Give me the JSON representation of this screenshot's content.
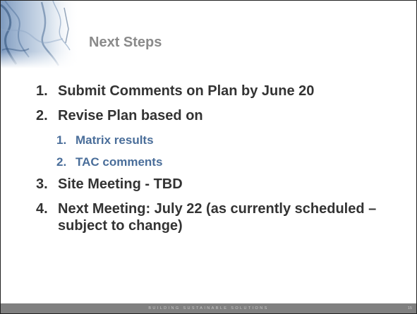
{
  "slide": {
    "title": "Next Steps",
    "items": [
      {
        "num": "1.",
        "text": "Submit Comments on Plan by June 20"
      },
      {
        "num": "2.",
        "text": "Revise Plan based on",
        "subitems": [
          {
            "num": "1.",
            "text": "Matrix results"
          },
          {
            "num": "2.",
            "text": "TAC comments"
          }
        ]
      },
      {
        "num": "3.",
        "text": "Site Meeting - TBD"
      },
      {
        "num": "4.",
        "text": "Next Meeting: July 22 (as currently scheduled – subject to change)"
      }
    ],
    "footer_tagline": "BUILDING SUSTAINABLE SOLUTIONS",
    "page_number": "15"
  },
  "colors": {
    "title": "#8a8a8a",
    "body_text": "#333333",
    "subitem_text": "#4a6e9a",
    "footer_bar": "#808080"
  }
}
